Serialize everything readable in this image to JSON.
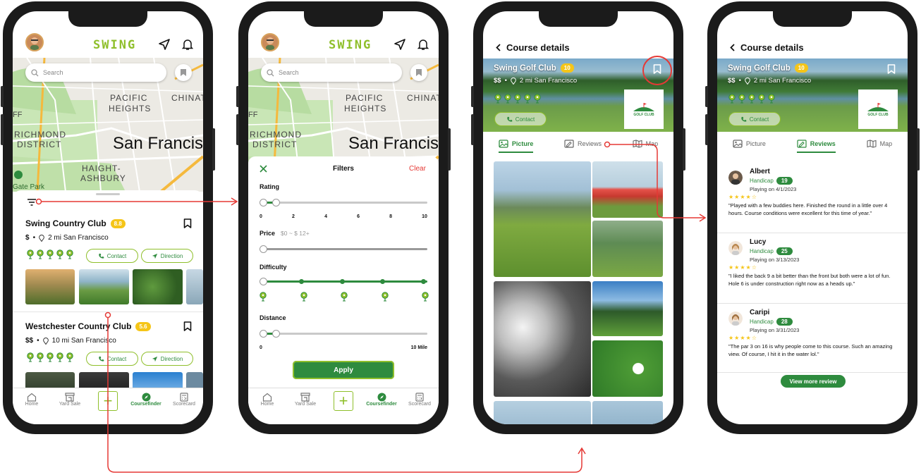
{
  "app": {
    "logo": "SWING"
  },
  "map": {
    "search_placeholder": "Search",
    "labels": {
      "pacific": "PACIFIC",
      "heights": "HEIGHTS",
      "chinat": "CHINAT",
      "ff": "FF",
      "richmond": "RICHMOND",
      "district": "DISTRICT",
      "haight": "HAIGHT-",
      "ashbury": "ASHBURY",
      "gate_park": "Gate Park",
      "city": "San Francisco"
    }
  },
  "list": {
    "courses": [
      {
        "name": "Swing Country Club",
        "rating": "8.8",
        "price": "$",
        "distance": "2 mi San Francisco",
        "contact": "Contact",
        "direction": "Direction"
      },
      {
        "name": "Westchester Country Club",
        "rating": "5.6",
        "price": "$$",
        "distance": "10 mi San Francisco",
        "contact": "Contact",
        "direction": "Direction"
      }
    ]
  },
  "tabbar": {
    "home": "Home",
    "yard_sale": "Yard Sale",
    "coursefinder": "Coursefinder",
    "scorecard": "Scorecard"
  },
  "filters": {
    "title": "Filters",
    "clear": "Clear",
    "rating_label": "Rating",
    "rating_ticks": [
      "0",
      "2",
      "4",
      "6",
      "8",
      "10"
    ],
    "price_label": "Price",
    "price_range": "$0 ~ $ 12+",
    "difficulty_label": "Difficulty",
    "distance_label": "Distance",
    "distance_min": "0",
    "distance_max": "10 Mile",
    "apply": "Apply"
  },
  "details": {
    "title": "Course details",
    "course_name": "Swing Golf Club",
    "rating": "10",
    "price": "$$",
    "distance": "2 mi San Francisco",
    "contact": "Contact",
    "logo_text": "GOLF CLUB",
    "tabs": {
      "picture": "Picture",
      "reviews": "Reviews",
      "map": "Map"
    },
    "reviews": [
      {
        "name": "Albert",
        "handicap_label": "Handicap",
        "handicap": "19",
        "date": "Playing on 4/1/2023",
        "stars": "★★★★☆",
        "text": "\"Played with a few buddies here. Finished the round in a little over 4 hours. Course conditions were excellent for this time of year.\""
      },
      {
        "name": "Lucy",
        "handicap_label": "Handicap",
        "handicap": "25",
        "date": "Playing on 3/13/2023",
        "stars": "★★★★☆",
        "text": "\"I liked the back 9 a bit better than the front but both were a lot of fun. Hole 6 is under construction right now as a heads up.\""
      },
      {
        "name": "Caripi",
        "handicap_label": "Handicap",
        "handicap": "28",
        "date": "Playing on 3/31/2023",
        "stars": "★★★★☆",
        "text": "\"The par 3 on 16 is why people come to this course. Such an amazing view. Of course, I hit it in the water lol.\""
      }
    ],
    "view_more": "View more review"
  },
  "colors": {
    "brand_green": "#2e8b3e",
    "accent_lime": "#8fbf2b",
    "badge_yellow": "#f5c518",
    "arrow_red": "#e53935"
  }
}
